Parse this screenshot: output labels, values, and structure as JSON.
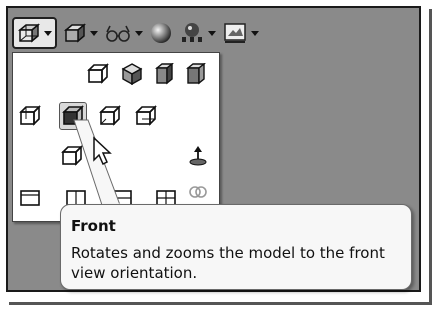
{
  "toolbar": {
    "items": [
      {
        "icon": "view-orientation-icon",
        "has_dropdown": true,
        "active": true
      },
      {
        "icon": "display-style-icon",
        "has_dropdown": true
      },
      {
        "icon": "hide-show-items-icon",
        "has_dropdown": true
      },
      {
        "icon": "edit-appearance-icon",
        "has_dropdown": false
      },
      {
        "icon": "apply-scene-icon",
        "has_dropdown": true
      },
      {
        "icon": "view-settings-icon",
        "has_dropdown": true
      }
    ]
  },
  "view_panel": {
    "selected": "front"
  },
  "tooltip": {
    "title": "Front",
    "description": "Rotates and zooms the model to the front view orientation."
  },
  "colors": {
    "background": "#8a8a8a",
    "panel": "#ffffff",
    "tooltip": "#f7f7f7"
  }
}
